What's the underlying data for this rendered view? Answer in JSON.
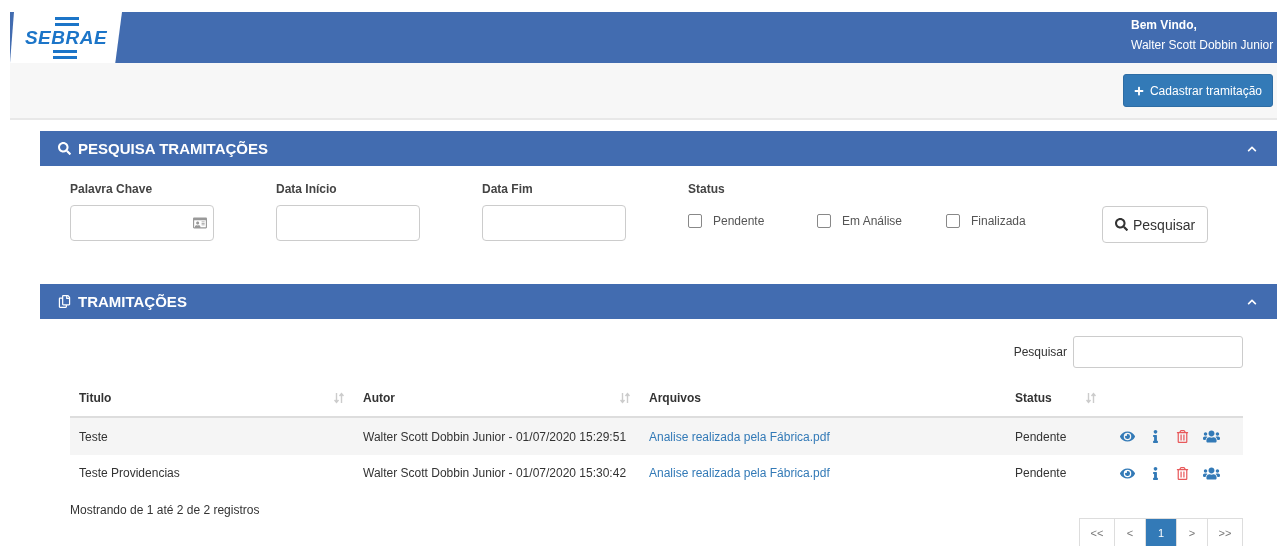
{
  "header": {
    "logo": "SEBRAE",
    "greeting": "Bem Vindo,",
    "user": "Walter Scott Dobbin Junior"
  },
  "toolbar": {
    "add_button": "Cadastrar tramitação"
  },
  "search_panel": {
    "title": "PESQUISA TRAMITAÇÕES",
    "expanded": true,
    "fields": [
      {
        "label": "Palavra Chave",
        "kind": "card"
      },
      {
        "label": "Data Início",
        "kind": "plain"
      },
      {
        "label": "Data Fim",
        "kind": "plain"
      }
    ],
    "status_label": "Status",
    "statuses": [
      {
        "label": "Pendente",
        "checked": false
      },
      {
        "label": "Em Análise",
        "checked": false
      },
      {
        "label": "Finalizada",
        "checked": false
      }
    ],
    "search_button": "Pesquisar"
  },
  "list_panel": {
    "title": "TRAMITAÇÕES",
    "expanded": true,
    "filter_label": "Pesquisar",
    "columns": [
      {
        "label": "Titulo",
        "sortable": true
      },
      {
        "label": "Autor",
        "sortable": true
      },
      {
        "label": "Arquivos",
        "sortable": false
      },
      {
        "label": "Status",
        "sortable": true
      }
    ],
    "rows": [
      {
        "title": "Teste",
        "author": "Walter Scott Dobbin Junior - 01/07/2020 15:29:51",
        "file": "Analise realizada pela Fábrica.pdf",
        "status": "Pendente"
      },
      {
        "title": "Teste Providencias",
        "author": "Walter Scott Dobbin Junior - 01/07/2020 15:30:42",
        "file": "Analise realizada pela Fábrica.pdf",
        "status": "Pendente"
      }
    ],
    "summary": "Mostrando de 1 até 2 de 2 registros",
    "pages": [
      {
        "label": "<<",
        "selected": false
      },
      {
        "label": "<",
        "selected": false
      },
      {
        "label": "1",
        "selected": true
      },
      {
        "label": ">",
        "selected": false
      },
      {
        "label": ">>",
        "selected": false
      }
    ]
  }
}
